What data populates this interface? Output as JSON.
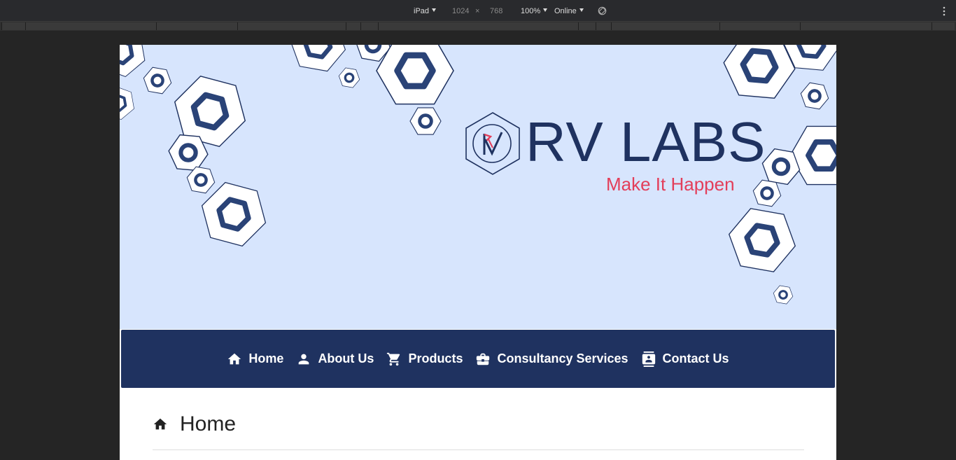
{
  "devtools": {
    "device": "iPad",
    "width": "1024",
    "times": "×",
    "height": "768",
    "zoom": "100%",
    "network": "Online",
    "icons": [
      "caret-down-icon",
      "rotate-icon",
      "kebab-menu-icon"
    ]
  },
  "site": {
    "brand_name": "RV LABS",
    "tagline": "Make It Happen",
    "logo_icon": "rv-hexagon-logo",
    "colors": {
      "navy": "#1f3260",
      "accent": "#e33e5a",
      "hero_bg": "#d7e5fd"
    }
  },
  "nav": {
    "items": [
      {
        "label": "Home",
        "icon": "home-icon"
      },
      {
        "label": "About Us",
        "icon": "person-icon"
      },
      {
        "label": "Products",
        "icon": "cart-icon"
      },
      {
        "label": "Consultancy Services",
        "icon": "briefcase-icon"
      },
      {
        "label": "Contact Us",
        "icon": "contact-card-icon"
      }
    ]
  },
  "page": {
    "title": "Home",
    "icon": "home-icon"
  }
}
